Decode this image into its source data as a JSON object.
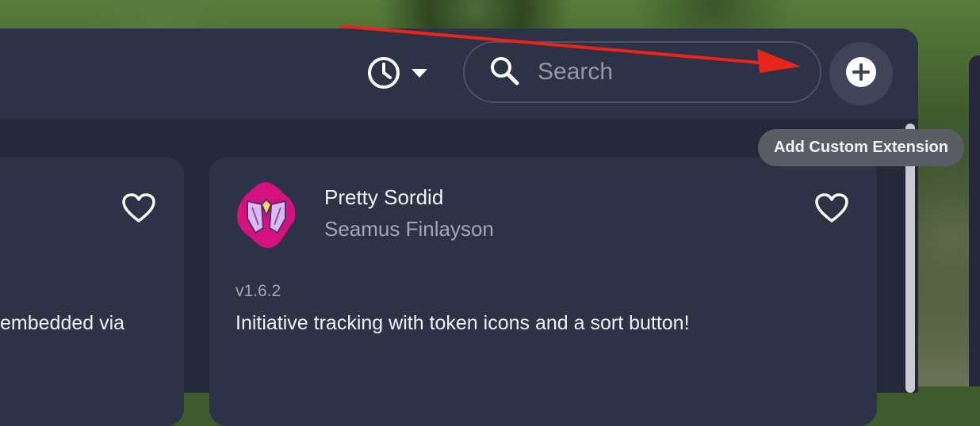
{
  "header": {
    "history_icon": "clock-icon",
    "search": {
      "placeholder": "Search",
      "value": ""
    },
    "add_button_icon": "plus-circle-icon"
  },
  "tooltip": {
    "text": "Add Custom Extension"
  },
  "cards": [
    {
      "partial_description": "embedded via"
    },
    {
      "title": "Pretty Sordid",
      "author": "Seamus Finlayson",
      "version": "v1.6.2",
      "description": "Initiative tracking with token icons and a sort button!",
      "icon": "pretty-sordid-logo"
    }
  ],
  "colors": {
    "panel": "#252839",
    "card": "#2e3246",
    "accent_arrow": "#e8251b",
    "logo_pink": "#d4117f",
    "logo_lavender": "#d9b4ef"
  }
}
